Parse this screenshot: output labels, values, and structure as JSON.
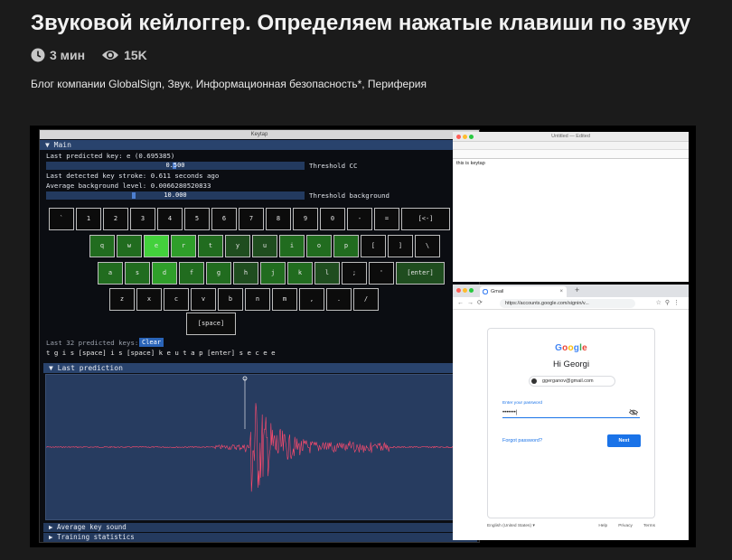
{
  "article": {
    "title": "Звуковой кейлоггер. Определяем нажатые клавиши по звуку",
    "read_time": "3 мин",
    "views": "15K",
    "hubs": "Блог компании GlobalSign, Звук, Информационная безопасность*, Периферия"
  },
  "keytap": {
    "window_title": "Keytap",
    "main_section": "▼ Main",
    "last_predicted_key": "Last predicted key:      e (0.695385)",
    "threshold_cc_value": "0.500",
    "threshold_cc_fraction": 0.5,
    "threshold_cc_label": "Threshold CC",
    "last_stroke": "Last detected key stroke: 0.611 seconds ago",
    "avg_bg": "Average background level:  0.0066280520833",
    "threshold_bg_value": "10.000",
    "threshold_bg_fraction": 0.34,
    "threshold_bg_label": "Threshold background",
    "keyboard_rows": [
      [
        {
          "label": "`",
          "level": 0
        },
        {
          "label": "1",
          "level": 0
        },
        {
          "label": "2",
          "level": 0
        },
        {
          "label": "3",
          "level": 0
        },
        {
          "label": "4",
          "level": 0
        },
        {
          "label": "5",
          "level": 0
        },
        {
          "label": "6",
          "level": 0
        },
        {
          "label": "7",
          "level": 0
        },
        {
          "label": "8",
          "level": 0
        },
        {
          "label": "9",
          "level": 0
        },
        {
          "label": "0",
          "level": 0
        },
        {
          "label": "-",
          "level": 0
        },
        {
          "label": "=",
          "level": 0
        },
        {
          "label": "[<-]",
          "level": 0
        }
      ],
      [
        {
          "label": "q",
          "level": 2
        },
        {
          "label": "w",
          "level": 2
        },
        {
          "label": "e",
          "level": 4
        },
        {
          "label": "r",
          "level": 3
        },
        {
          "label": "t",
          "level": 2
        },
        {
          "label": "y",
          "level": 1
        },
        {
          "label": "u",
          "level": 1
        },
        {
          "label": "i",
          "level": 2
        },
        {
          "label": "o",
          "level": 2
        },
        {
          "label": "p",
          "level": 2
        },
        {
          "label": "[",
          "level": 0
        },
        {
          "label": "]",
          "level": 0
        },
        {
          "label": "\\",
          "level": 0
        }
      ],
      [
        {
          "label": "a",
          "level": 2
        },
        {
          "label": "s",
          "level": 2
        },
        {
          "label": "d",
          "level": 3
        },
        {
          "label": "f",
          "level": 2
        },
        {
          "label": "g",
          "level": 2
        },
        {
          "label": "h",
          "level": 1
        },
        {
          "label": "j",
          "level": 2
        },
        {
          "label": "k",
          "level": 2
        },
        {
          "label": "l",
          "level": 1
        },
        {
          "label": ";",
          "level": 0
        },
        {
          "label": "'",
          "level": 0
        },
        {
          "label": "[enter]",
          "level": 1
        }
      ],
      [
        {
          "label": "z",
          "level": 0
        },
        {
          "label": "x",
          "level": 0
        },
        {
          "label": "c",
          "level": 0
        },
        {
          "label": "v",
          "level": 0
        },
        {
          "label": "b",
          "level": 0
        },
        {
          "label": "n",
          "level": 0
        },
        {
          "label": "m",
          "level": 0
        },
        {
          "label": ",",
          "level": 0
        },
        {
          "label": ".",
          "level": 0
        },
        {
          "label": "/",
          "level": 0
        }
      ],
      [
        {
          "label": "[space]",
          "level": 0
        }
      ]
    ],
    "last_32_label": "Last 32 predicted keys:",
    "clear_label": "Clear",
    "predicted_keys": "t g i s [space] i s [space] k e u t a p [enter] s e c e e",
    "last_prediction": "▼ Last prediction",
    "average_key_sound": "▶ Average key sound",
    "training_statistics": "▶ Training statistics",
    "waveform_color": "#ff4b6e",
    "highlight_colors": [
      "#0c0c0c",
      "#1f4d1f",
      "#216c1f",
      "#2f9e2a",
      "#43d13c"
    ]
  },
  "textedit": {
    "title": "Untitled — Edited",
    "body": "this is keytap"
  },
  "chrome": {
    "tab_title": "Gmail",
    "url": "https://accounts.google.com/signin/v..."
  },
  "google": {
    "logo_letters": [
      {
        "ch": "G",
        "color": "#4285f4"
      },
      {
        "ch": "o",
        "color": "#ea4335"
      },
      {
        "ch": "o",
        "color": "#fbbc05"
      },
      {
        "ch": "g",
        "color": "#4285f4"
      },
      {
        "ch": "l",
        "color": "#34a853"
      },
      {
        "ch": "e",
        "color": "#ea4335"
      }
    ],
    "greeting": "Hi Georgi",
    "account": "ggerganov@gmail.com",
    "password_label": "Enter your password",
    "password_value": "•••••••|",
    "forgot": "Forgot password?",
    "next": "Next",
    "footer_language": "English (United States)",
    "footer_links": [
      "Help",
      "Privacy",
      "Terms"
    ]
  }
}
